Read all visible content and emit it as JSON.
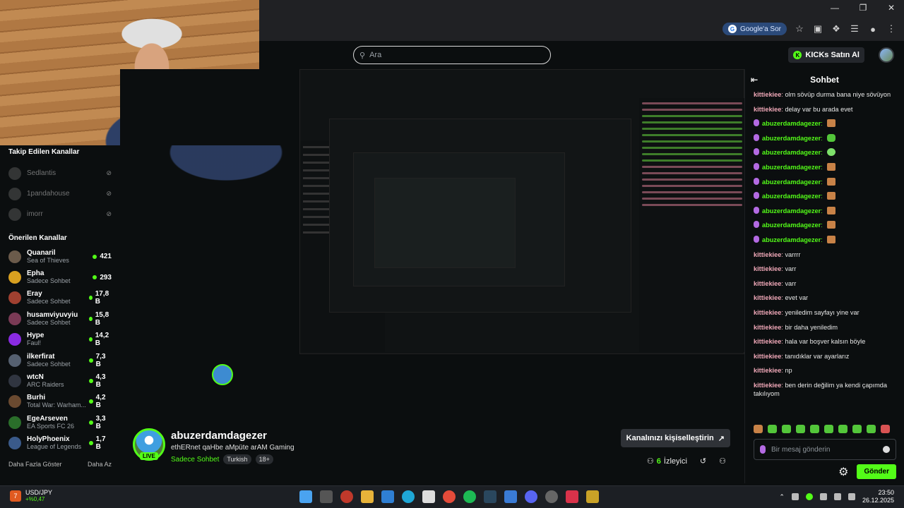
{
  "browser": {
    "ask_google": "Google'a Sor"
  },
  "kick": {
    "search_placeholder": "Ara",
    "kicks_button": "KICKs Satın Al"
  },
  "sidebar": {
    "followed_title": "Takip Edilen Kanallar",
    "followed": [
      {
        "name": "Sedlantis"
      },
      {
        "name": "1pandahouse"
      },
      {
        "name": "imorr"
      }
    ],
    "recommended_title": "Önerilen Kanallar",
    "recommended": [
      {
        "name": "Quanaril",
        "category": "Sea of Thieves",
        "viewers": "421",
        "color": "#6b5b4b"
      },
      {
        "name": "Epha",
        "category": "Sadece Sohbet",
        "viewers": "293",
        "color": "#d8a020"
      },
      {
        "name": "Eray",
        "category": "Sadece Sohbet",
        "viewers": "17,8 B",
        "color": "#a04030"
      },
      {
        "name": "husamviyuvyiu",
        "category": "Sadece Sohbet",
        "viewers": "15,8 B",
        "color": "#7a3a55"
      },
      {
        "name": "Hype",
        "category": "Faul!",
        "viewers": "14,2 B",
        "color": "#8a2be2"
      },
      {
        "name": "ilkerfirat",
        "category": "Sadece Sohbet",
        "viewers": "7,3 B",
        "color": "#556070"
      },
      {
        "name": "wtcN",
        "category": "ARC Raiders",
        "viewers": "4,3 B",
        "color": "#303540"
      },
      {
        "name": "Burhi",
        "category": "Total War: Warham...",
        "viewers": "4,2 B",
        "color": "#6a4a30"
      },
      {
        "name": "EgeArseven",
        "category": "EA Sports FC 26",
        "viewers": "3,3 B",
        "color": "#2a6e2a"
      },
      {
        "name": "HolyPhoenix",
        "category": "League of Legends",
        "viewers": "1,7 B",
        "color": "#3a5a8a"
      }
    ],
    "show_more": "Daha Fazla Göster",
    "show_less": "Daha Az"
  },
  "stream": {
    "streamer": "abuzerdamdagezer",
    "live": "LIVE",
    "title": "ethERnet qaHbe aMpüte arAM Gaming",
    "category": "Sadece Sohbet",
    "tags": [
      "Turkish",
      "18+"
    ],
    "customize": "Kanalınızı kişiselleştirin",
    "viewer_count": "6",
    "viewer_label": "İzleyici"
  },
  "chat": {
    "title": "Sohbet",
    "messages": [
      {
        "user": "kittiekiee",
        "text": "olm sövüp durma bana niye sövüyon",
        "kind": "pink"
      },
      {
        "user": "kittiekiee",
        "text": "delay var bu arada evet",
        "kind": "pink"
      },
      {
        "user": "abuzerdamdagezer",
        "emote": "mail",
        "kind": "green"
      },
      {
        "user": "abuzerdamdagezer",
        "emote": "green",
        "kind": "green"
      },
      {
        "user": "abuzerdamdagezer",
        "emote": "face",
        "kind": "green"
      },
      {
        "user": "abuzerdamdagezer",
        "emote": "mail",
        "kind": "green"
      },
      {
        "user": "abuzerdamdagezer",
        "emote": "mail",
        "kind": "green"
      },
      {
        "user": "abuzerdamdagezer",
        "emote": "mail",
        "kind": "green"
      },
      {
        "user": "abuzerdamdagezer",
        "emote": "mail",
        "kind": "green"
      },
      {
        "user": "abuzerdamdagezer",
        "emote": "mail",
        "kind": "green"
      },
      {
        "user": "abuzerdamdagezer",
        "emote": "mail",
        "kind": "green"
      },
      {
        "user": "kittiekiee",
        "text": "varrrr",
        "kind": "pink"
      },
      {
        "user": "kittiekiee",
        "text": "varr",
        "kind": "pink"
      },
      {
        "user": "kittiekiee",
        "text": "varr",
        "kind": "pink"
      },
      {
        "user": "kittiekiee",
        "text": "evet var",
        "kind": "pink"
      },
      {
        "user": "kittiekiee",
        "text": "yeniledim sayfayı yine var",
        "kind": "pink"
      },
      {
        "user": "kittiekiee",
        "text": "bir daha yeniledim",
        "kind": "pink"
      },
      {
        "user": "kittiekiee",
        "text": "hala var boşver kalsın böyle",
        "kind": "pink"
      },
      {
        "user": "kittiekiee",
        "text": "tanıdıklar var ayarlarız",
        "kind": "pink"
      },
      {
        "user": "kittiekiee",
        "text": "np",
        "kind": "pink"
      },
      {
        "user": "kittiekiee",
        "text": "ben derin değilim ya kendi çapımda takılıyom",
        "kind": "pink"
      }
    ],
    "input_placeholder": "Bir mesaj gönderin",
    "send": "Gönder"
  },
  "taskbar": {
    "ticker_pair": "USD/JPY",
    "ticker_change": "+%0,47",
    "time": "23:50",
    "date": "26.12.2025"
  },
  "colors": {
    "accent": "#53fc18",
    "username_pink": "#f0a8b8",
    "background": "#0b0e0f"
  }
}
